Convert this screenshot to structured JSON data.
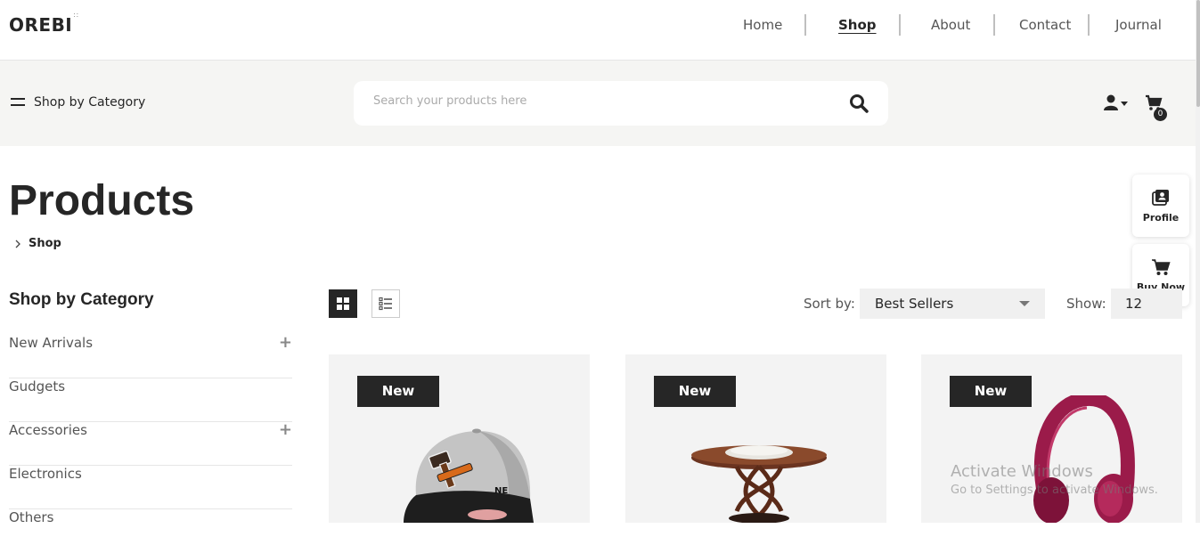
{
  "brand": {
    "logo": "OREBI",
    "logo_mark": "::"
  },
  "nav": {
    "items": [
      {
        "label": "Home",
        "active": false
      },
      {
        "label": "Shop",
        "active": true
      },
      {
        "label": "About",
        "active": false
      },
      {
        "label": "Contact",
        "active": false
      },
      {
        "label": "Journal",
        "active": false
      }
    ]
  },
  "toolbar": {
    "category_toggle": "Shop by Category",
    "search_placeholder": "Search your products here",
    "cart_count": "0"
  },
  "page": {
    "title": "Products",
    "breadcrumb": "Shop"
  },
  "floating": {
    "profile_label": "Profile",
    "buy_label": "Buy Now"
  },
  "sidebar": {
    "title": "Shop by Category",
    "items": [
      {
        "label": "New Arrivals",
        "expandable": true
      },
      {
        "label": "Gudgets",
        "expandable": false
      },
      {
        "label": "Accessories",
        "expandable": true
      },
      {
        "label": "Electronics",
        "expandable": false
      },
      {
        "label": "Others",
        "expandable": false
      }
    ]
  },
  "listing": {
    "sort_label": "Sort by:",
    "sort_value": "Best Sellers",
    "show_label": "Show:",
    "show_value": "12"
  },
  "products": [
    {
      "badge": "New",
      "image": "cap"
    },
    {
      "badge": "New",
      "image": "round-table"
    },
    {
      "badge": "New",
      "image": "headphones"
    }
  ],
  "watermark": {
    "line1": "Activate Windows",
    "line2": "Go to Settings to activate Windows."
  },
  "colors": {
    "primary": "#262626",
    "band": "#f5f5f3",
    "card": "#f3f3f3",
    "headphone": "#9b1b4a"
  }
}
